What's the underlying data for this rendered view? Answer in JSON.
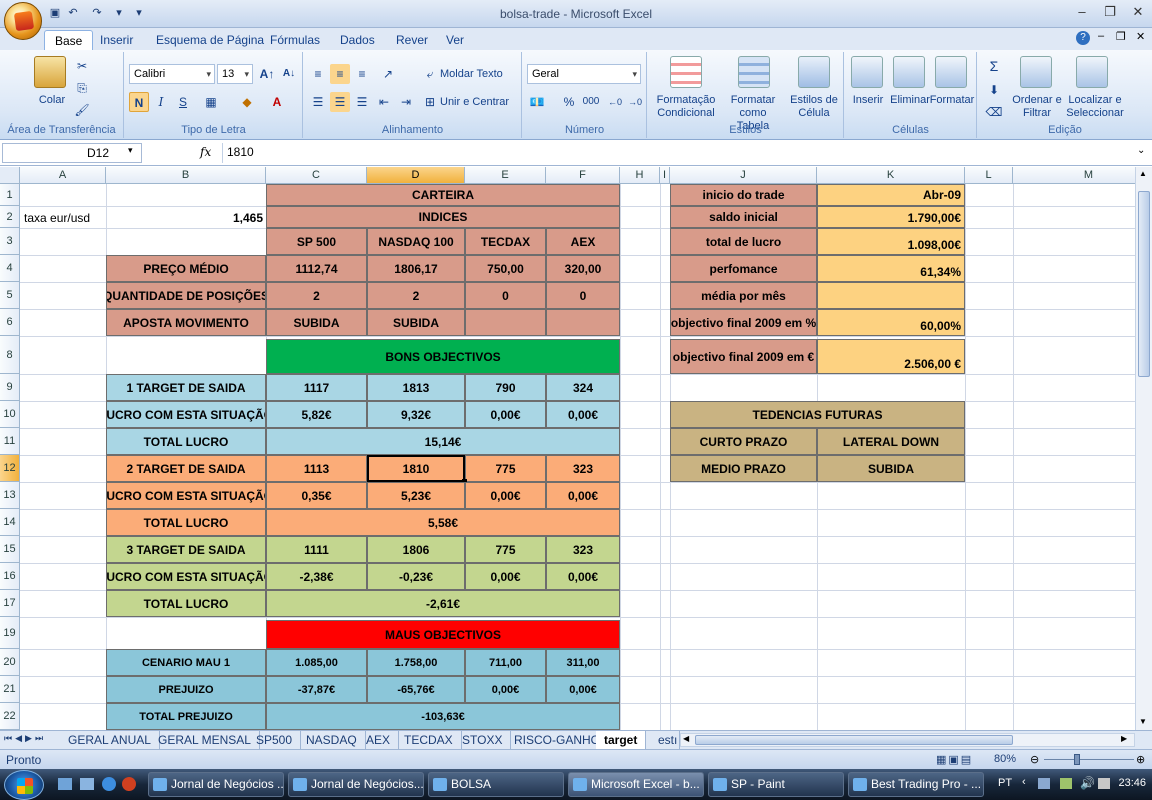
{
  "window": {
    "title": "bolsa-trade - Microsoft Excel"
  },
  "ribbon_tabs": [
    "Base",
    "Inserir",
    "Esquema de Página",
    "Fórmulas",
    "Dados",
    "Rever",
    "Ver"
  ],
  "ribbon": {
    "clipboard": {
      "paste": "Colar",
      "label": "Área de Transferência"
    },
    "font": {
      "name": "Calibri",
      "size": "13",
      "bold": "N",
      "italic": "I",
      "underline": "S",
      "label": "Tipo de Letra"
    },
    "alignment": {
      "wrap": "Moldar Texto",
      "merge": "Unir e Centrar",
      "label": "Alinhamento"
    },
    "number": {
      "format": "Geral",
      "percent": "%",
      "thousands": "000",
      "label": "Número"
    },
    "styles": {
      "cond": "Formatação Condicional",
      "table": "Formatar como Tabela",
      "cell": "Estilos de Célula",
      "label": "Estilos"
    },
    "cells": {
      "insert": "Inserir",
      "delete": "Eliminar",
      "format": "Formatar",
      "label": "Células"
    },
    "editing": {
      "sum": "Σ",
      "sort": "Ordenar e Filtrar",
      "find": "Localizar e Seleccionar",
      "label": "Edição"
    }
  },
  "formula_bar": {
    "name_box": "D12",
    "fx": "fx",
    "content": "1810"
  },
  "columns": [
    "A",
    "B",
    "C",
    "D",
    "E",
    "F",
    "H",
    "I",
    "J",
    "K",
    "L",
    "M"
  ],
  "rows": [
    "1",
    "2",
    "3",
    "4",
    "5",
    "6",
    "8",
    "9",
    "10",
    "11",
    "12",
    "13",
    "14",
    "15",
    "16",
    "17",
    "19",
    "20",
    "21",
    "22"
  ],
  "sheet": {
    "taxa_label": "taxa eur/usd",
    "taxa_value": "1,465",
    "carteira": "CARTEIRA",
    "indices": "INDICES",
    "idx": [
      "SP 500",
      "NASDAQ 100",
      "TECDAX",
      "AEX"
    ],
    "preco_label": "PREÇO MÉDIO",
    "preco": [
      "1112,74",
      "1806,17",
      "750,00",
      "320,00"
    ],
    "qtd_label": "QUANTIDADE DE POSIÇÕES",
    "qtd": [
      "2",
      "2",
      "0",
      "0"
    ],
    "aposta_label": "APOSTA MOVIMENTO",
    "aposta": [
      "SUBIDA",
      "SUBIDA",
      "",
      ""
    ],
    "bons": "BONS OBJECTIVOS",
    "t1_label": "1 TARGET DE SAIDA",
    "t1": [
      "1117",
      "1813",
      "790",
      "324"
    ],
    "l1_label": "LUCRO COM ESTA SITUAÇÃO",
    "l1": [
      "5,82€",
      "9,32€",
      "0,00€",
      "0,00€"
    ],
    "tot1_label": "TOTAL LUCRO",
    "tot1": "15,14€",
    "t2_label": "2 TARGET DE SAIDA",
    "t2": [
      "1113",
      "1810",
      "775",
      "323"
    ],
    "l2_label": "LUCRO COM ESTA SITUAÇÃO",
    "l2": [
      "0,35€",
      "5,23€",
      "0,00€",
      "0,00€"
    ],
    "tot2_label": "TOTAL LUCRO",
    "tot2": "5,58€",
    "t3_label": "3 TARGET DE SAIDA",
    "t3": [
      "1111",
      "1806",
      "775",
      "323"
    ],
    "l3_label": "LUCRO COM ESTA SITUAÇÃO",
    "l3": [
      "-2,38€",
      "-0,23€",
      "0,00€",
      "0,00€"
    ],
    "tot3_label": "TOTAL LUCRO",
    "tot3": "-2,61€",
    "maus": "MAUS OBJECTIVOS",
    "m1_label": "CENARIO MAU 1",
    "m1": [
      "1.085,00",
      "1.758,00",
      "711,00",
      "311,00"
    ],
    "p1_label": "PREJUIZO",
    "p1": [
      "-37,87€",
      "-65,76€",
      "0,00€",
      "0,00€"
    ],
    "totp_label": "TOTAL  PREJUIZO",
    "totp": "-103,63€",
    "inicio_label": "inicio do trade",
    "inicio": "Abr-09",
    "saldo_label": "saldo inicial",
    "saldo": "1.790,00€",
    "lucro_label": "total de lucro",
    "lucro": "1.098,00€",
    "perf_label": "perfomance",
    "perf": "61,34%",
    "media_label": "média por mês",
    "media": "",
    "obj_pct_label": "objectivo final 2009 em %",
    "obj_pct": "60,00%",
    "obj_eur_label": "objectivo final 2009 em €",
    "obj_eur": "2.506,00 €",
    "tend": "TEDENCIAS FUTURAS",
    "curto_label": "CURTO PRAZO",
    "curto": "LATERAL DOWN",
    "medio_label": "MEDIO PRAZO",
    "medio": "SUBIDA"
  },
  "sheet_tabs": [
    "GERAL ANUAL",
    "GERAL MENSAL",
    "SP500",
    "NASDAQ",
    "AEX",
    "TECDAX",
    "STOXX",
    "RISCO-GANHO",
    "target",
    "estı"
  ],
  "active_sheet": "target",
  "status": {
    "ready": "Pronto",
    "zoom": "80%"
  },
  "taskbar": {
    "items": [
      "Jornal de Negócios ...",
      "Jornal de Negócios...",
      "BOLSA",
      "Microsoft Excel - b...",
      "SP - Paint",
      "Best Trading Pro - ..."
    ],
    "lang": "PT",
    "clock": "23:46"
  }
}
